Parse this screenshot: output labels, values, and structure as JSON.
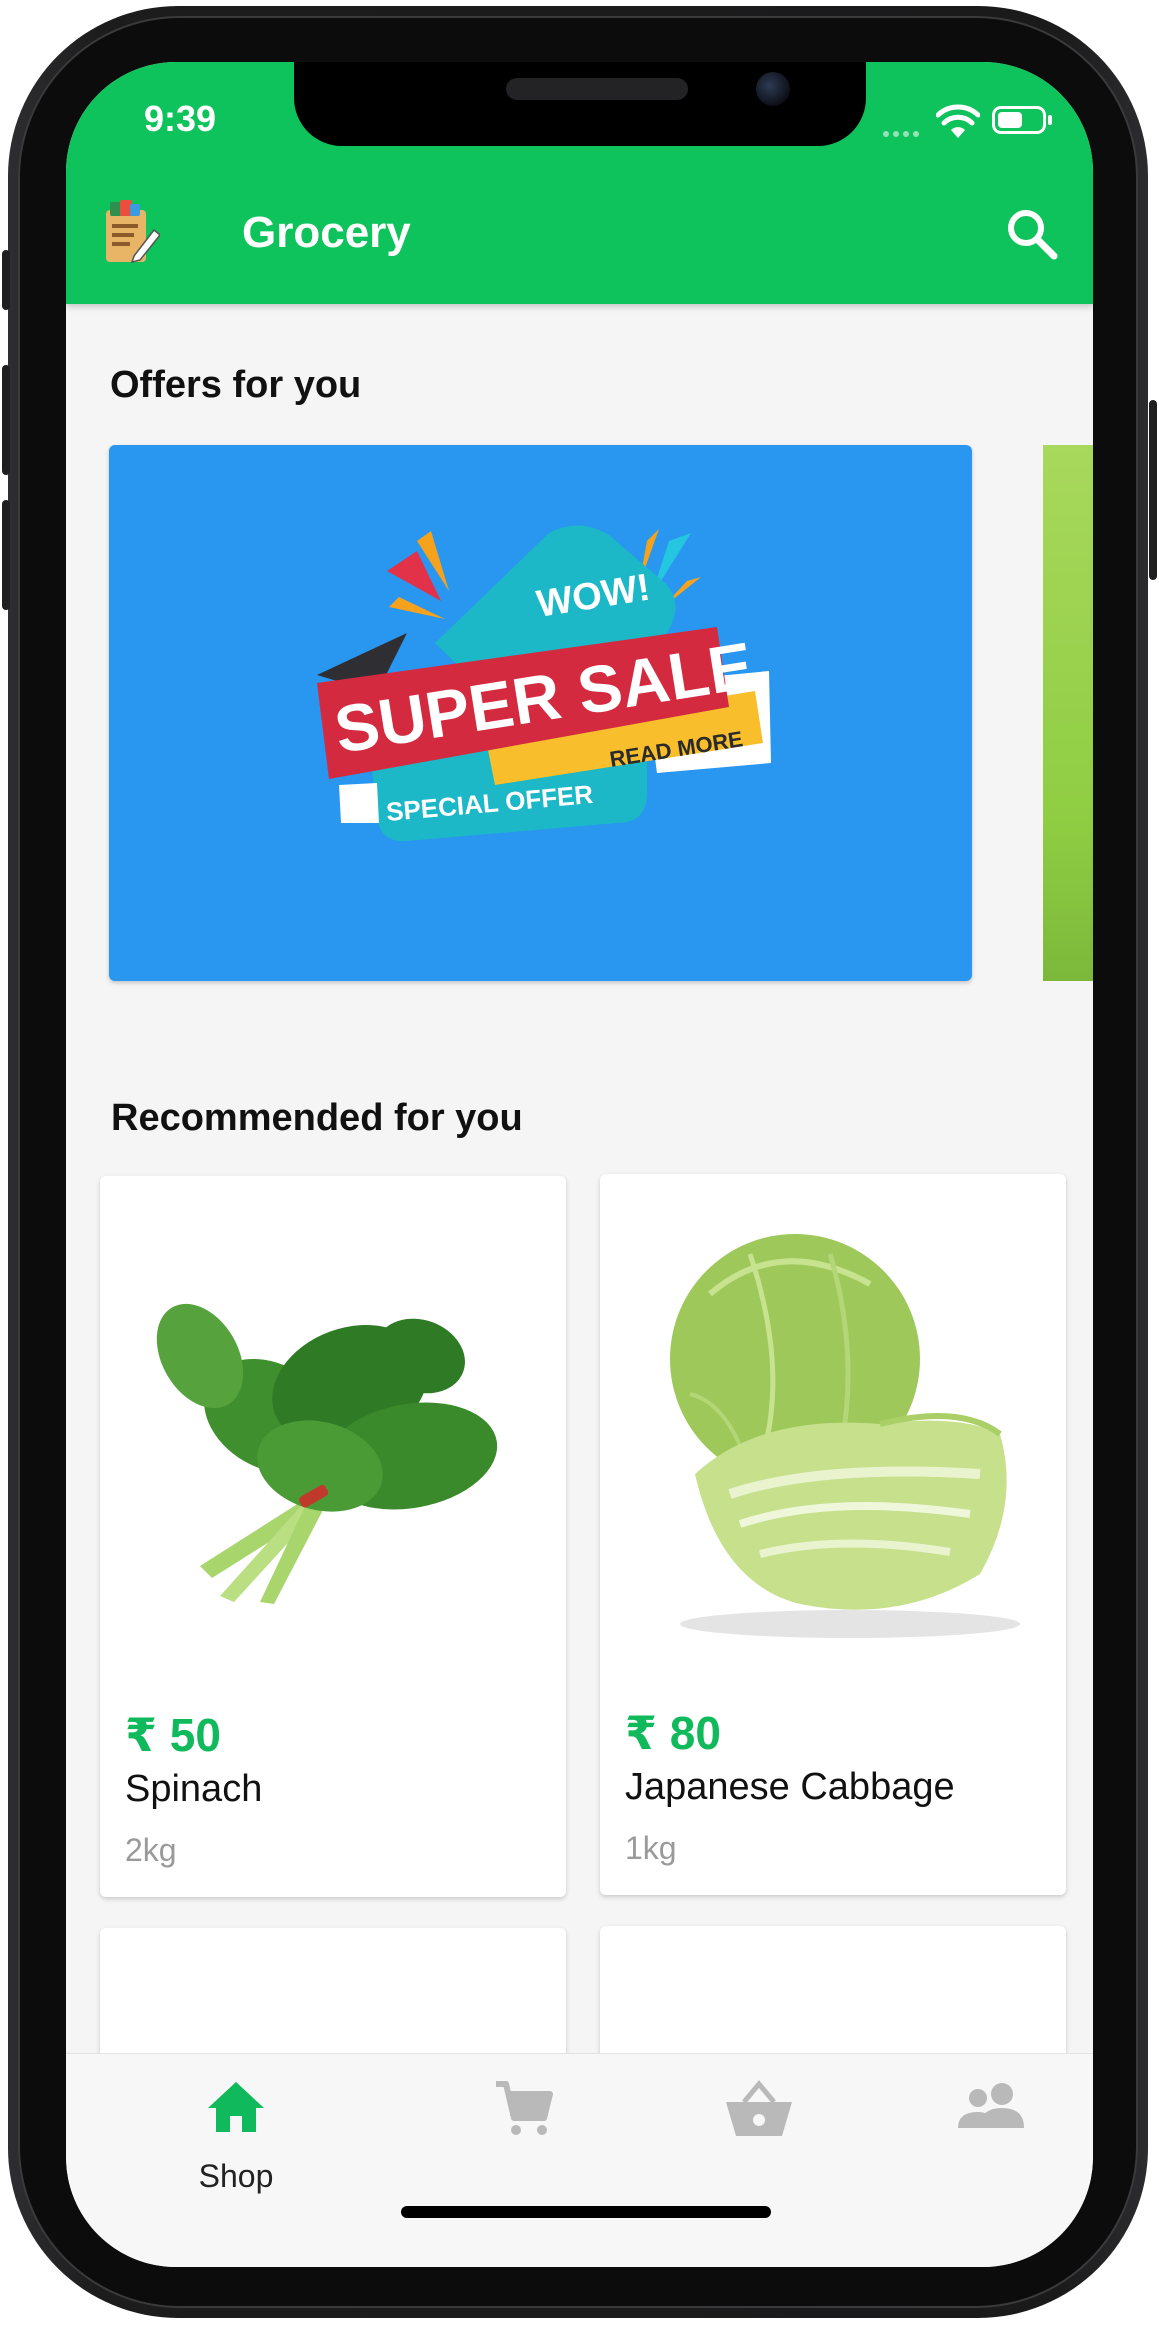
{
  "status_bar": {
    "time": "9:39"
  },
  "app_bar": {
    "title": "Grocery",
    "accent": "#0fc35c"
  },
  "offers": {
    "heading": "Offers for you",
    "banner": {
      "background": "#2996ef",
      "text_wow": "WOW!",
      "text_main": "SUPER SALE",
      "text_read_more": "READ MORE",
      "text_special": "SPECIAL OFFER"
    }
  },
  "recommended": {
    "heading": "Recommended for you",
    "products": [
      {
        "price": "₹ 50",
        "name": "Spinach",
        "unit": "2kg"
      },
      {
        "price": "₹ 80",
        "name": "Japanese Cabbage",
        "unit": "1kg"
      }
    ]
  },
  "bottom_nav": {
    "items": [
      {
        "label": "Shop",
        "icon": "home-icon",
        "active": true
      },
      {
        "label": "",
        "icon": "cart-icon",
        "active": false
      },
      {
        "label": "",
        "icon": "basket-icon",
        "active": false
      },
      {
        "label": "",
        "icon": "people-icon",
        "active": false
      }
    ],
    "active_color": "#10b95b",
    "inactive_color": "#b9b9b9"
  }
}
